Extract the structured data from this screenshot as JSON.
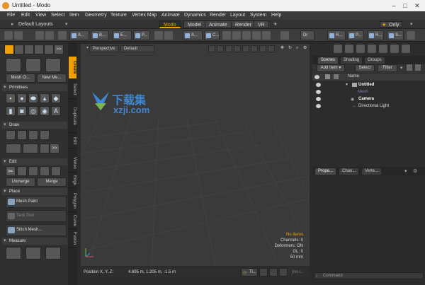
{
  "window": {
    "title": "Untitled - Modo",
    "controls": [
      "–",
      "□",
      "✕"
    ]
  },
  "menu": [
    "File",
    "Edit",
    "View",
    "Select",
    "Item",
    "Geometry",
    "Texture",
    "Vertex Map",
    "Animate",
    "Dynamics",
    "Render",
    "Layout",
    "System",
    "Help"
  ],
  "layout_bar": {
    "layouts_label": "Default Layouts",
    "tabs": [
      "Modo",
      "Model",
      "Animate",
      "Render",
      "VR"
    ],
    "active_tab": "Modo",
    "add": "+",
    "only_label": "Only"
  },
  "toolbar": {
    "buttons": [
      "A...",
      "B...",
      "E...",
      "P...",
      "A...",
      "C...",
      "Dr",
      "R...",
      "P...",
      "R...",
      "S..."
    ]
  },
  "left_panel": {
    "top_buttons": [
      "Mesh Cl...",
      "New Me..."
    ],
    "sections": {
      "primitives": "Primitives",
      "draw": "Draw",
      "edit": "Edit",
      "place": "Place",
      "measure": "Measure"
    },
    "edit_buttons": [
      "Unmerge",
      "Merge"
    ],
    "place_tools": [
      "Mesh Paint",
      "Tack Tool",
      "Stitch Mesh..."
    ],
    "more": ">>"
  },
  "side_tabs": [
    "Create",
    "Select",
    "Duplicate",
    "Edit",
    "Vertex",
    "Edge",
    "Polygon",
    "Curve",
    "Fusion"
  ],
  "viewport": {
    "view_label": "Perspective",
    "shading_label": "Default",
    "info": {
      "no_items": "No Items",
      "channels": "Channels: 0",
      "deformers": "Deformers: ON",
      "gl": "GL: 0",
      "scale": "50 mm"
    }
  },
  "status_bar": {
    "position_label": "Position X, Y, Z:",
    "position_value": "4.695 m, 1.205 m, -1.5 m",
    "timeline_btn": "Ti...",
    "input_placeholder": "(no i..."
  },
  "scenes_panel": {
    "tabs": [
      "Scenes",
      "Shading",
      "Groups"
    ],
    "add_item": "Add Item",
    "select": "Select",
    "filter": "Filter",
    "name_header": "Name",
    "tree": [
      "Untitled",
      "Mesh",
      "Camera",
      "Directional Light"
    ]
  },
  "properties_panel": {
    "tabs": [
      "Prope...",
      "Chan...",
      "Verte..."
    ],
    "command_placeholder": "Command"
  },
  "watermark": {
    "cn": "下载集",
    "url": "xzji.com"
  },
  "colors": {
    "accent": "#f0a000",
    "bg": "#2b2b2b",
    "panel": "#303030",
    "icon_blue": "#8fb3d6"
  }
}
